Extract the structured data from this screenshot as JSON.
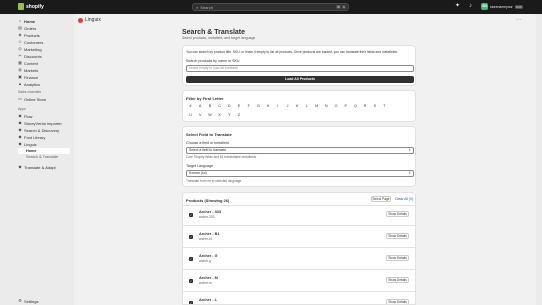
{
  "topbar": {
    "logo_text": "shopify",
    "search_placeholder": "Search",
    "shortcut_keys": [
      "⌘",
      "K"
    ],
    "store_initials": "SN",
    "store_name": "storenameyour",
    "store_badge": "SNS"
  },
  "sidebar": {
    "items": [
      {
        "label": "Home",
        "icon": "home-icon",
        "glyph": "⌂"
      },
      {
        "label": "Orders",
        "icon": "orders-icon",
        "glyph": "▤"
      },
      {
        "label": "Products",
        "icon": "products-icon",
        "glyph": "◈"
      },
      {
        "label": "Customers",
        "icon": "customers-icon",
        "glyph": "☺"
      },
      {
        "label": "Marketing",
        "icon": "marketing-icon",
        "glyph": "◎"
      },
      {
        "label": "Discounts",
        "icon": "discounts-icon",
        "glyph": "✂"
      },
      {
        "label": "Content",
        "icon": "content-icon",
        "glyph": "▦"
      },
      {
        "label": "Markets",
        "icon": "markets-icon",
        "glyph": "◍"
      },
      {
        "label": "Finance",
        "icon": "finance-icon",
        "glyph": "▣"
      },
      {
        "label": "Analytics",
        "icon": "analytics-icon",
        "glyph": "▲"
      }
    ],
    "sales_channels_label": "Sales channels",
    "sales_channels": [
      {
        "label": "Online Store",
        "icon": "online-store-icon",
        "glyph": "▭"
      }
    ],
    "apps_label": "Apps",
    "apps": [
      {
        "label": "Flow",
        "icon": "flow-icon",
        "glyph": "◆"
      },
      {
        "label": "StoreyVenta Importer",
        "icon": "importer-icon",
        "glyph": "◆"
      },
      {
        "label": "Search & Discovery",
        "icon": "search-discovery-icon",
        "glyph": "◆"
      },
      {
        "label": "Font Library",
        "icon": "font-library-icon",
        "glyph": "◆"
      },
      {
        "label": "Linguix",
        "icon": "linguix-icon",
        "glyph": "◆"
      }
    ],
    "linguix_sub": [
      {
        "label": "Home",
        "active": true
      },
      {
        "label": "Search & Translate",
        "active": false
      }
    ],
    "extra_app": {
      "label": "Translate & Adapt",
      "icon": "translate-adapt-icon",
      "glyph": "◆"
    },
    "settings_label": "Settings"
  },
  "app": {
    "name": "Linguix"
  },
  "page": {
    "title": "Search & Translate",
    "subtitle": "Select products, metafield, and target language"
  },
  "search_card": {
    "description": "You can search by product title, SKU, or leave it empty to list all products. Once products are loaded, you can translate their fields and metafields.",
    "field_label": "Search products by name or SKU",
    "placeholder": "Leave empty to load all products",
    "button_label": "Load All Products"
  },
  "filter_card": {
    "title": "Filter by First Letter",
    "letters": [
      "#",
      "A",
      "B",
      "C",
      "D",
      "E",
      "F",
      "G",
      "H",
      "I",
      "J",
      "K",
      "L",
      "M",
      "N",
      "O",
      "P",
      "Q",
      "R",
      "S",
      "T",
      "U",
      "V",
      "W",
      "X",
      "Y",
      "Z"
    ]
  },
  "field_card": {
    "title": "Select Field to Translate",
    "field_label": "Choose a field or metafield",
    "field_value": "Select a field to translate",
    "field_help": "Core Shopify fields and 81 translatable metafields",
    "language_label": "Target Language",
    "language_value": "Korean (ko)",
    "language_help": "Translate from en to selected language"
  },
  "products_card": {
    "title": "Products (Showing 26)",
    "select_page_label": "Select Page",
    "clear_all_label": "Clear All (0)",
    "details_label": "Show Details",
    "products": [
      {
        "title": "Archer - 333",
        "handle": "archer-333"
      },
      {
        "title": "Archer - B1",
        "handle": "archer-b1"
      },
      {
        "title": "Archer - G",
        "handle": "archer-g"
      },
      {
        "title": "Archer - M",
        "handle": "archer-m"
      },
      {
        "title": "Archer - L",
        "handle": "archer-l"
      }
    ]
  }
}
